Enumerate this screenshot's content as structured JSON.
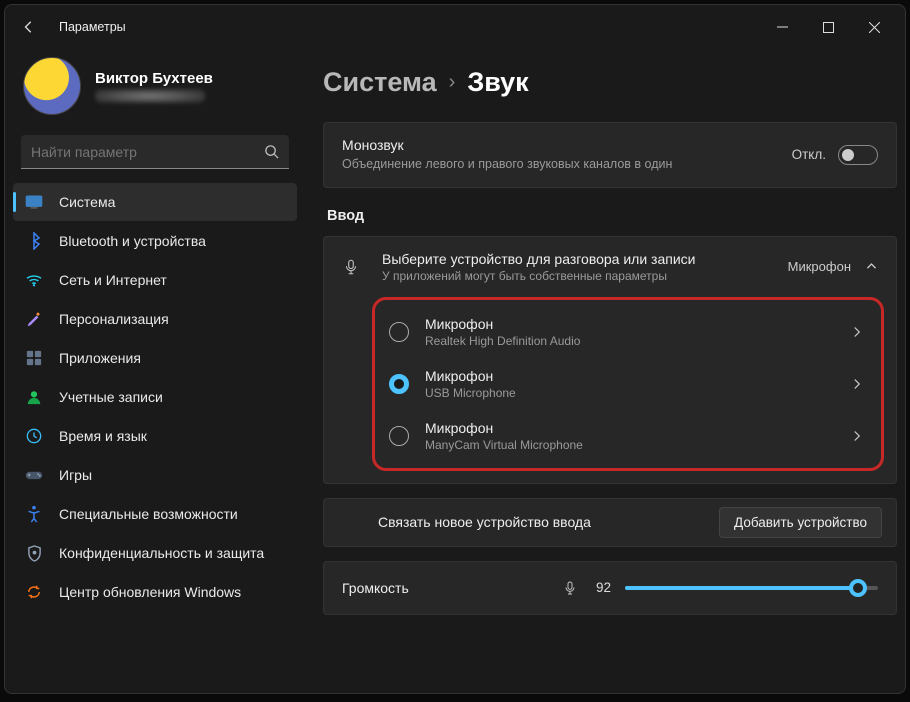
{
  "window": {
    "title": "Параметры"
  },
  "profile": {
    "name": "Виктор Бухтеев"
  },
  "search": {
    "placeholder": "Найти параметр"
  },
  "sidebar": {
    "items": [
      {
        "label": "Система",
        "icon": "system",
        "active": true
      },
      {
        "label": "Bluetooth и устройства",
        "icon": "bluetooth"
      },
      {
        "label": "Сеть и Интернет",
        "icon": "network"
      },
      {
        "label": "Персонализация",
        "icon": "personalize"
      },
      {
        "label": "Приложения",
        "icon": "apps"
      },
      {
        "label": "Учетные записи",
        "icon": "accounts"
      },
      {
        "label": "Время и язык",
        "icon": "time"
      },
      {
        "label": "Игры",
        "icon": "gaming"
      },
      {
        "label": "Специальные возможности",
        "icon": "accessibility"
      },
      {
        "label": "Конфиденциальность и защита",
        "icon": "privacy"
      },
      {
        "label": "Центр обновления Windows",
        "icon": "update"
      }
    ]
  },
  "breadcrumb": {
    "parent": "Система",
    "current": "Звук"
  },
  "mono": {
    "title": "Монозвук",
    "desc": "Объединение левого и правого звуковых каналов в один",
    "state": "Откл."
  },
  "input": {
    "section": "Ввод",
    "choose_title": "Выберите устройство для разговора или записи",
    "choose_sub": "У приложений могут быть собственные параметры",
    "value": "Микрофон",
    "devices": [
      {
        "title": "Микрофон",
        "sub": "Realtek High Definition Audio",
        "selected": false
      },
      {
        "title": "Микрофон",
        "sub": "USB Microphone",
        "selected": true
      },
      {
        "title": "Микрофон",
        "sub": "ManyCam Virtual Microphone",
        "selected": false
      }
    ],
    "pair_text": "Связать новое устройство ввода",
    "add_button": "Добавить устройство"
  },
  "volume": {
    "label": "Громкость",
    "value": "92",
    "percent": 92
  }
}
